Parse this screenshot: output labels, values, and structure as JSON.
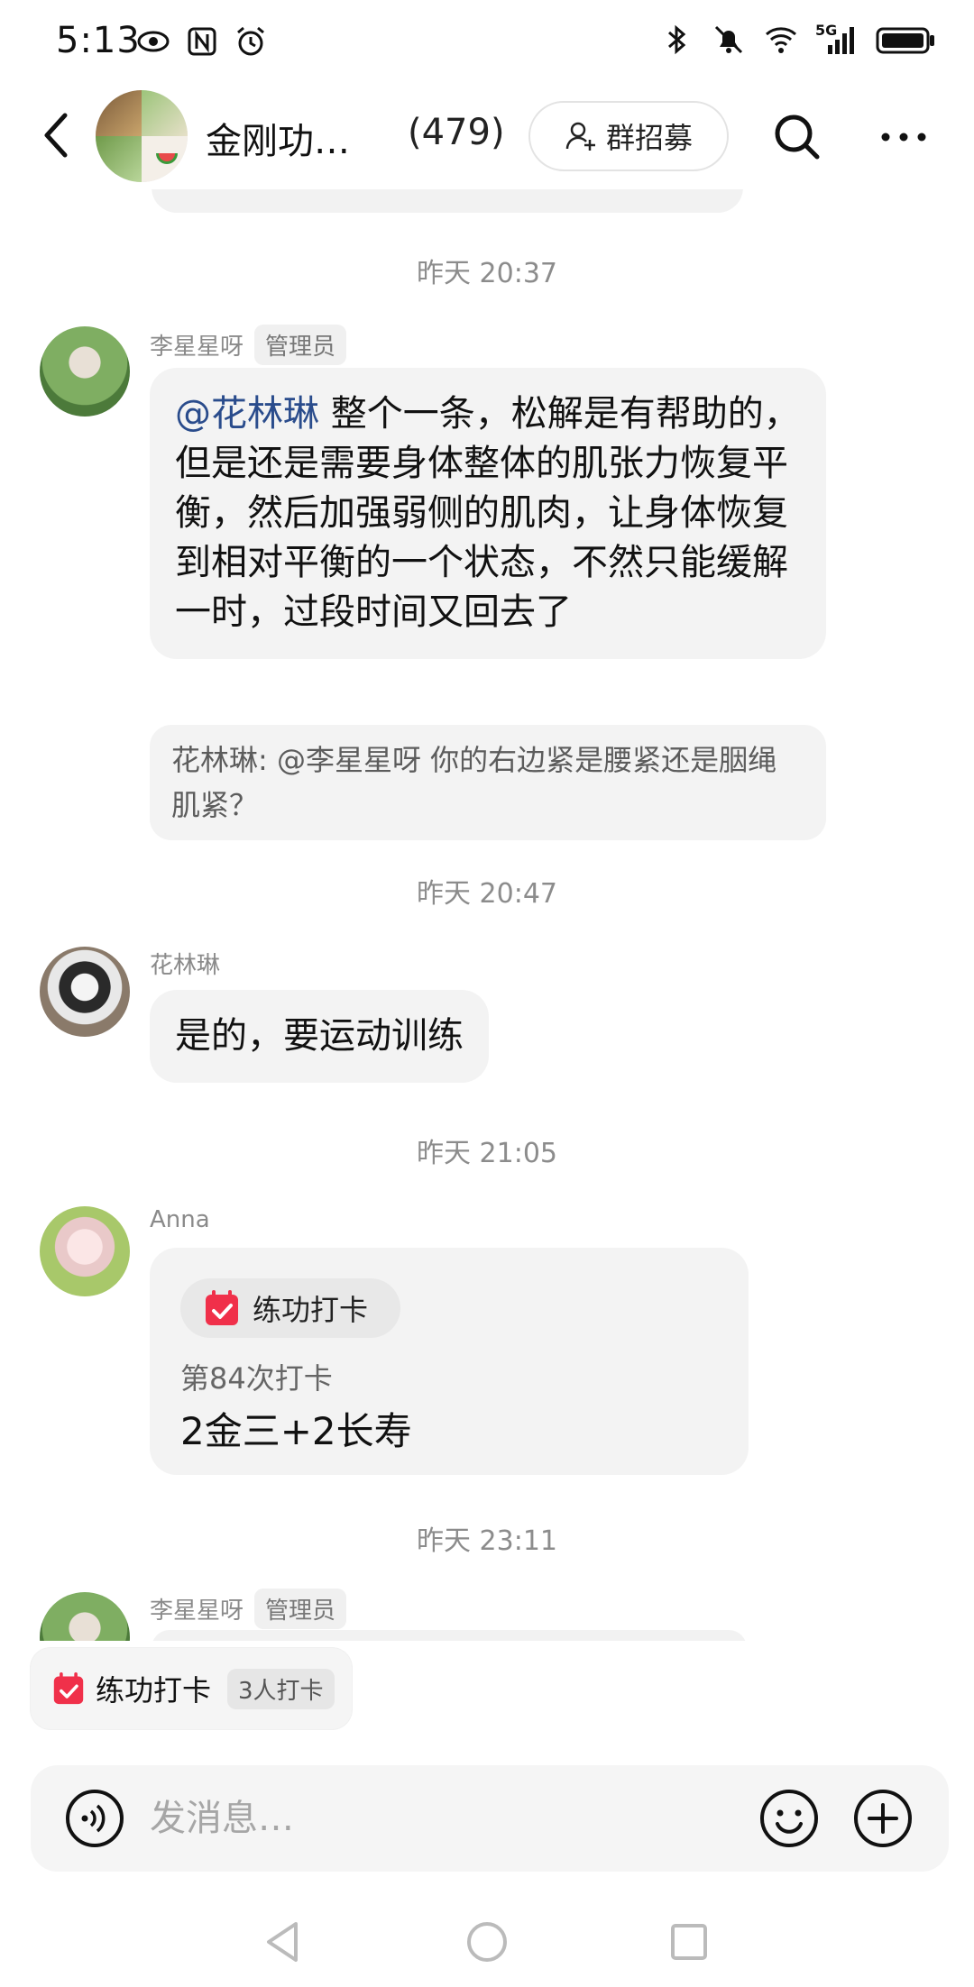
{
  "status_bar": {
    "time": "5:13",
    "network_label": "5G"
  },
  "header": {
    "group_name": "金刚功…",
    "member_count": "(479)",
    "recruit_label": "群招募"
  },
  "messages": [
    {
      "timestamp": "昨天 20:37",
      "sender": "李星星呀",
      "role": "管理员",
      "mention": "@花林琳",
      "text": " 整个一条，松解是有帮助的，但是还是需要身体整体的肌张力恢复平衡，然后加强弱侧的肌肉，让身体恢复到相对平衡的一个状态，不然只能缓解一时，过段时间又回去了",
      "quote": "花林琳: @李星星呀 你的右边紧是腰紧还是胭绳肌紧？"
    },
    {
      "timestamp": "昨天 20:47",
      "sender": "花林琳",
      "text": "是的，要运动训练"
    },
    {
      "timestamp": "昨天 21:05",
      "sender": "Anna",
      "checkin_title": "练功打卡",
      "checkin_count": "第84次打卡",
      "checkin_content": "2金三+2长寿"
    },
    {
      "timestamp": "昨天 23:11",
      "sender": "李星星呀",
      "role": "管理员"
    }
  ],
  "floating_checkin": {
    "label": "练功打卡",
    "count": "3人打卡"
  },
  "input_bar": {
    "placeholder": "发消息…"
  },
  "colors": {
    "mention": "#2a4c8c",
    "checkin_red": "#f0304a",
    "bubble_bg": "#f3f3f3"
  }
}
